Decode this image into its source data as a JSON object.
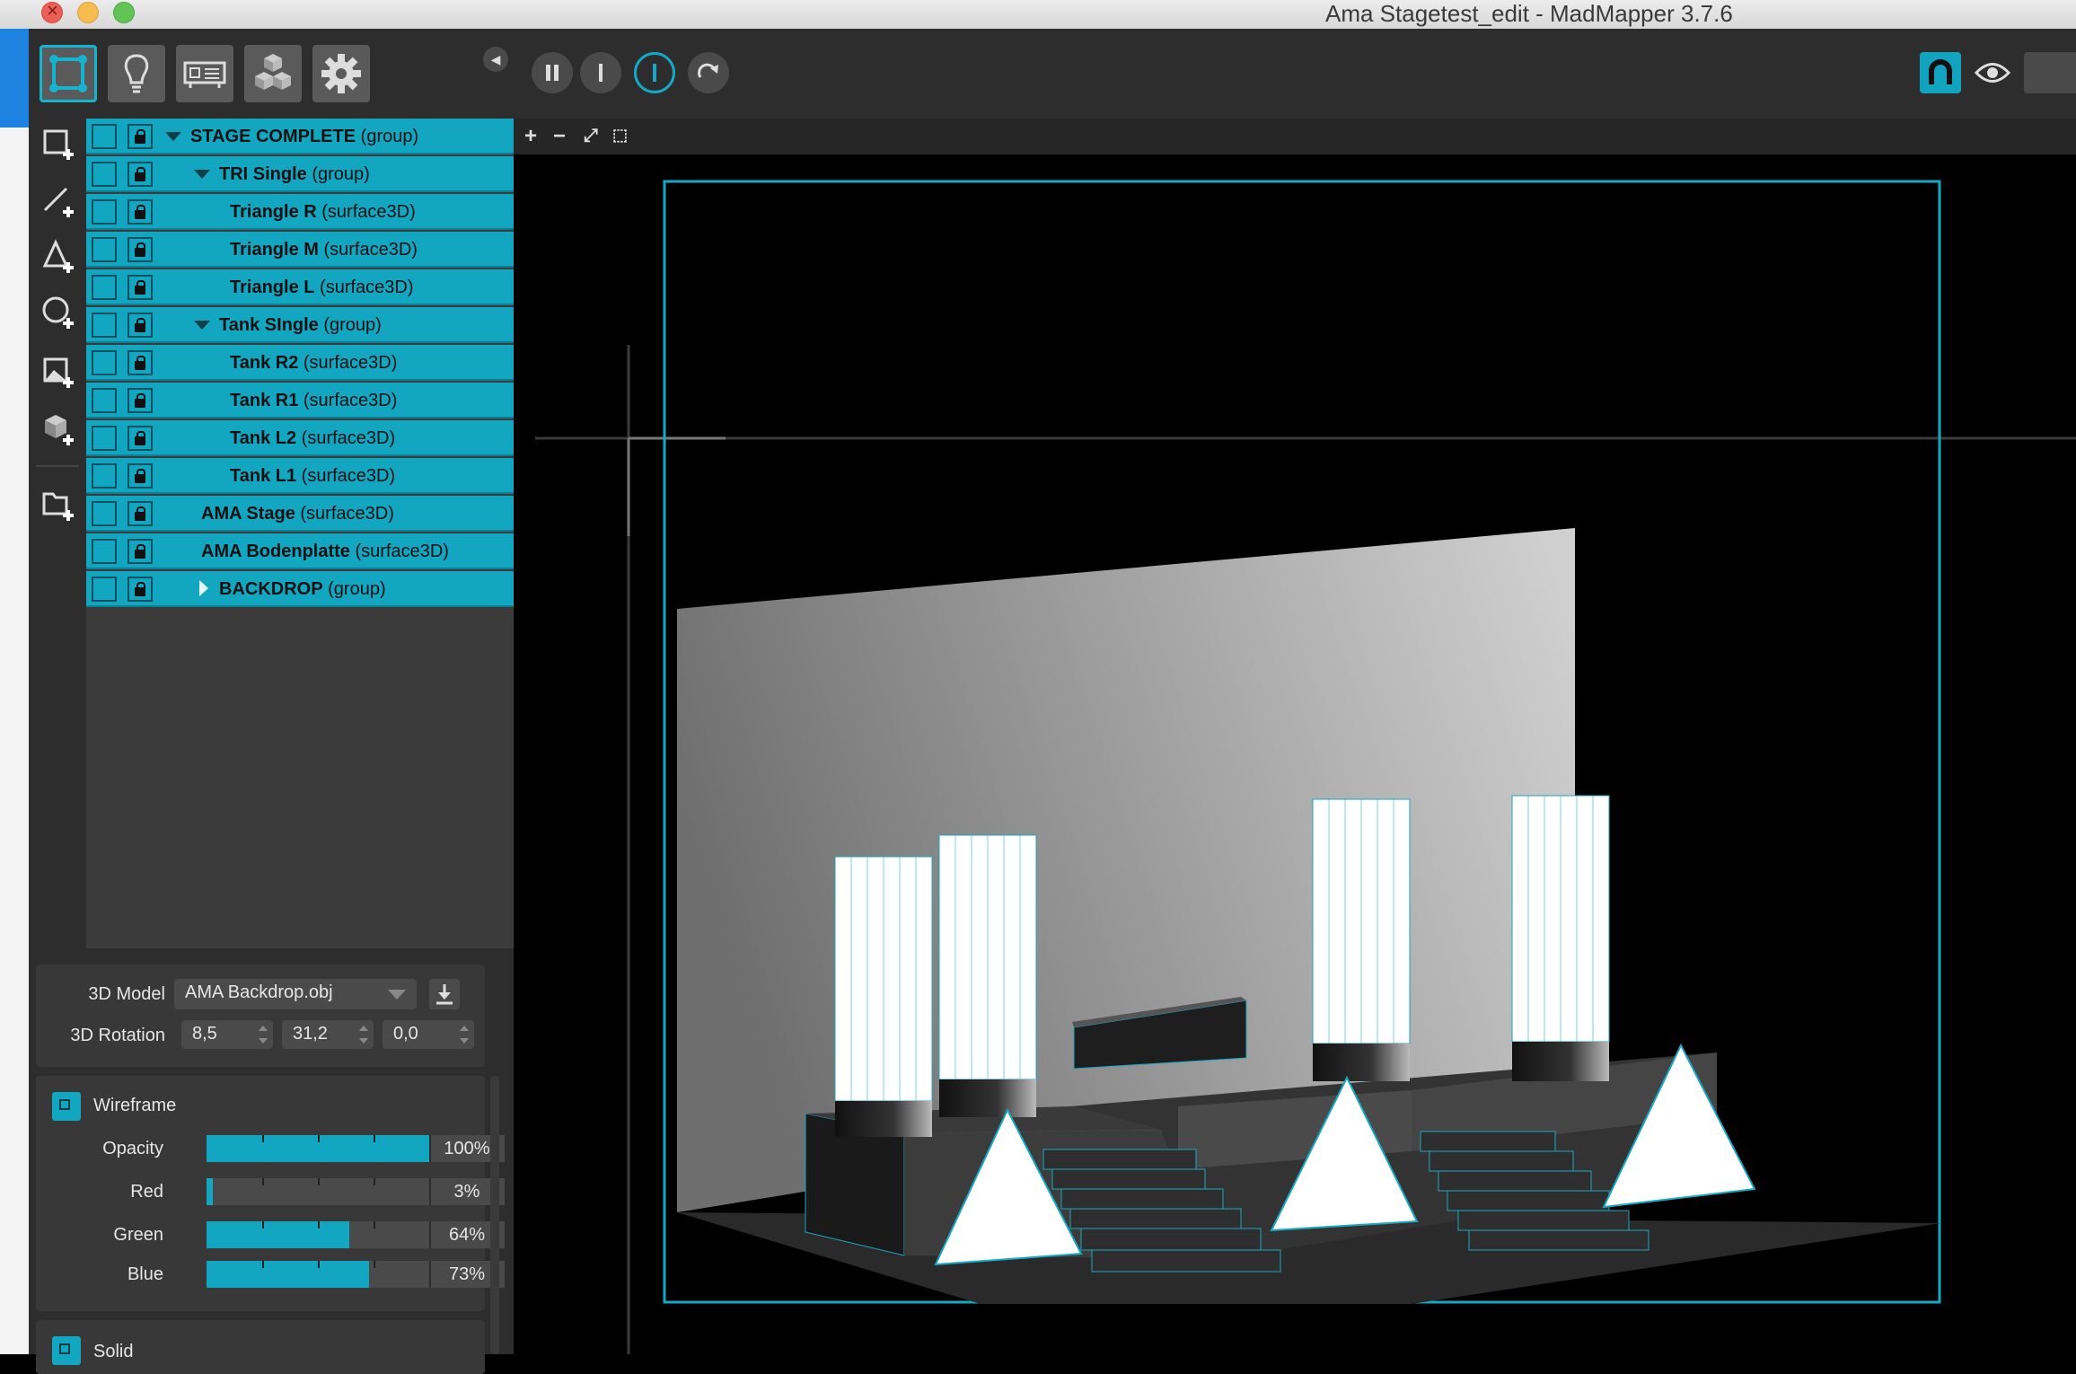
{
  "window": {
    "title": "Ama Stagetest_edit - MadMapper 3.7.6"
  },
  "toolbar": {
    "mode_buttons": [
      {
        "icon": "surface-mode-icon",
        "active": true
      },
      {
        "icon": "light-bulb-icon",
        "active": false
      },
      {
        "icon": "projector-icon",
        "active": false
      },
      {
        "icon": "cubes-icon",
        "active": false
      },
      {
        "icon": "gear-icon",
        "active": false
      }
    ],
    "transport": [
      "pause-icon",
      "stop-icon",
      "record-icon",
      "redo-icon"
    ]
  },
  "tools": [
    "add-quad-icon",
    "add-line-icon",
    "add-triangle-icon",
    "add-circle-icon",
    "add-mask-icon",
    "add-3d-icon",
    "add-folder-icon"
  ],
  "layers": [
    {
      "name": "STAGE COMPLETE",
      "type": "(group)",
      "level": 0,
      "expander": "down"
    },
    {
      "name": "TRI Single",
      "type": "(group)",
      "level": 1,
      "expander": "down"
    },
    {
      "name": "Triangle R",
      "type": "(surface3D)",
      "level": 2
    },
    {
      "name": "Triangle M",
      "type": "(surface3D)",
      "level": 2
    },
    {
      "name": "Triangle L",
      "type": "(surface3D)",
      "level": 2
    },
    {
      "name": "Tank SIngle",
      "type": "(group)",
      "level": 1,
      "expander": "down"
    },
    {
      "name": "Tank R2",
      "type": "(surface3D)",
      "level": 2
    },
    {
      "name": "Tank R1",
      "type": "(surface3D)",
      "level": 2
    },
    {
      "name": "Tank L2",
      "type": "(surface3D)",
      "level": 2
    },
    {
      "name": "Tank L1",
      "type": "(surface3D)",
      "level": 2
    },
    {
      "name": "AMA Stage",
      "type": "(surface3D)",
      "level": 1
    },
    {
      "name": "AMA Bodenplatte",
      "type": "(surface3D)",
      "level": 1
    },
    {
      "name": "BACKDROP",
      "type": "(group)",
      "level": 1,
      "expander": "right"
    }
  ],
  "properties": {
    "model_label": "3D Model",
    "model_value": "AMA Backdrop.obj",
    "rotation_label": "3D Rotation",
    "rotation": [
      "8,5",
      "31,2",
      "0,0"
    ],
    "wireframe_label": "Wireframe",
    "sliders": [
      {
        "label": "Opacity",
        "value": "100%",
        "fraction": 1.0
      },
      {
        "label": "Red",
        "value": "3%",
        "fraction": 0.03
      },
      {
        "label": "Green",
        "value": "64%",
        "fraction": 0.64
      },
      {
        "label": "Blue",
        "value": "73%",
        "fraction": 0.73
      }
    ],
    "solid_label": "Solid"
  },
  "viewport": {
    "tools": [
      "+",
      "−",
      "⤢",
      "⬚"
    ]
  },
  "colors": {
    "accent": "#12a6c1",
    "panel": "#2d2d2d",
    "layer_bg": "#3b3b3b"
  }
}
